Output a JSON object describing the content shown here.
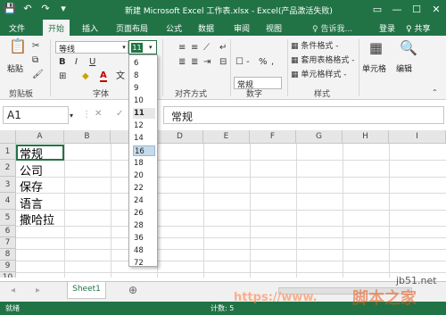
{
  "window": {
    "title": "新建 Microsoft Excel 工作表.xlsx - Excel(产品激活失败)",
    "qat": {
      "save_icon": "💾",
      "undo_icon": "↶",
      "redo_icon": "↷",
      "customize_icon": "▾"
    },
    "controls": {
      "restore": "▭",
      "minimize": "—",
      "maximize": "☐",
      "close": "✕"
    }
  },
  "tabs": [
    "文件",
    "开始",
    "插入",
    "页面布局",
    "公式",
    "数据",
    "审阅",
    "视图"
  ],
  "active_tab": "开始",
  "tell_me": "♀ 告诉我...",
  "login": "登录",
  "share": "♀ 共享",
  "ribbon": {
    "clipboard": {
      "paste_label": "粘贴",
      "group_label": "剪贴板"
    },
    "font": {
      "font_name": "等线",
      "font_size": "11",
      "bold": "B",
      "italic": "I",
      "underline": "U",
      "grow": "A",
      "shrink": "A",
      "font_color": "A",
      "phonetic": "文",
      "group_label": "字体"
    },
    "alignment": {
      "group_label": "对齐方式"
    },
    "number": {
      "format": "常规",
      "currency": "☐ -",
      "percent": "%",
      "comma": ",",
      "group_label": "数字"
    },
    "styles": {
      "conditional": "条件格式 -",
      "table": "套用表格格式 -",
      "cell_styles": "单元格样式 -",
      "group_label": "样式"
    },
    "cells": {
      "label": "单元格"
    },
    "editing": {
      "label": "编辑"
    }
  },
  "formula_bar": {
    "name_box": "A1",
    "cancel": "✕",
    "enter": "✓",
    "fx": "fx",
    "content": "常规"
  },
  "columns": [
    "A",
    "B",
    "C",
    "D",
    "E",
    "F",
    "G",
    "H",
    "I"
  ],
  "rows": [
    "1",
    "2",
    "3",
    "4",
    "5",
    "6",
    "7",
    "8",
    "9",
    "10"
  ],
  "cells": {
    "A1": "常规",
    "A2": "公司",
    "A3": "保存",
    "A4": "语言",
    "A5": "撒哈拉"
  },
  "size_dropdown": {
    "options": [
      "6",
      "8",
      "9",
      "10",
      "11",
      "12",
      "14",
      "16",
      "18",
      "20",
      "22",
      "24",
      "26",
      "28",
      "36",
      "48",
      "72"
    ],
    "hovered": "16",
    "current": "11"
  },
  "sheet": {
    "tab": "Sheet1",
    "add": "⊕",
    "prev": "◂",
    "next": "▸"
  },
  "status": {
    "ready": "就绪",
    "count": "计数: 5"
  },
  "watermark": {
    "site": "jb51.net",
    "url": "https://www.",
    "brand": "脚本之家"
  },
  "colors": {
    "accent": "#217346",
    "hover": "#c5dbe9"
  }
}
